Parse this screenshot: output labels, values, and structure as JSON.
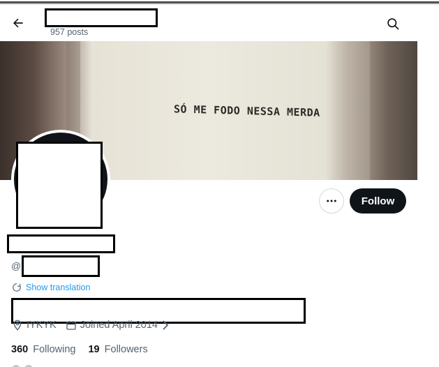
{
  "header": {
    "back_icon": "arrow-left-icon",
    "posts_count": "957 posts",
    "search_icon": "search-icon"
  },
  "banner": {
    "text": "SÓ ME FODO NESSA MERDA"
  },
  "actions": {
    "more_icon": "more-dots-icon",
    "follow_label": "Follow"
  },
  "profile": {
    "handle_prefix": "@",
    "show_translation": "Show translation",
    "location": "IYKYK",
    "joined": "Joined April 2014",
    "following_count": "360",
    "following_label": "Following",
    "followers_count": "19",
    "followers_label": "Followers"
  },
  "colors": {
    "accent": "#1d9bf0",
    "text_primary": "#0f1419",
    "text_secondary": "#536471",
    "follow_bg": "#0f1419"
  }
}
